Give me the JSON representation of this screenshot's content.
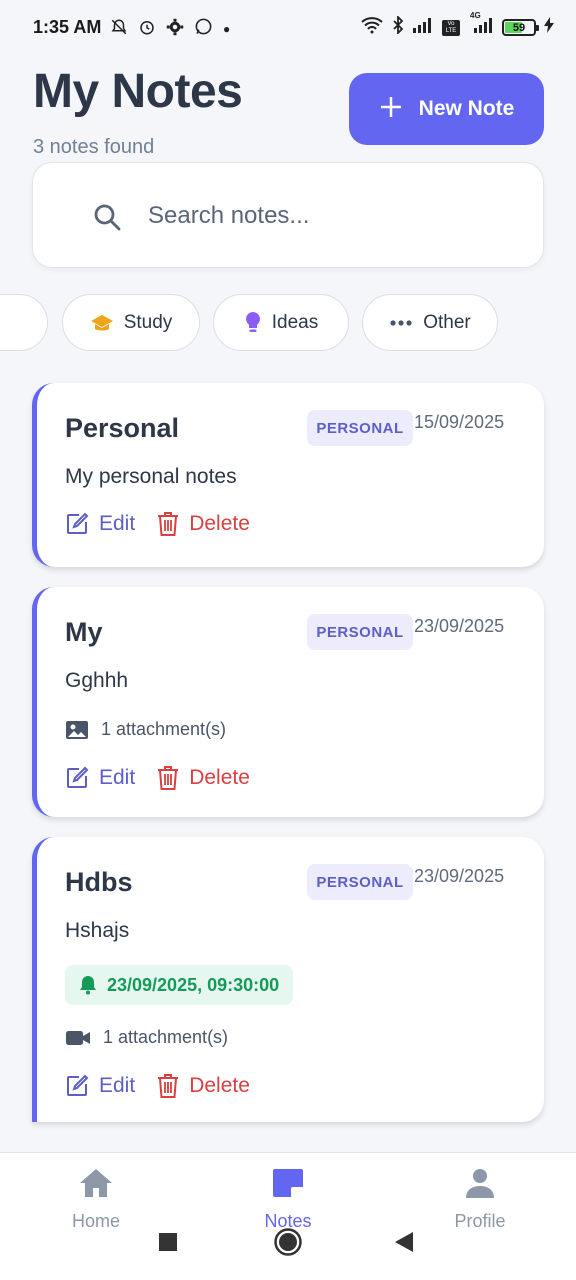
{
  "status_bar": {
    "time": "1:35 AM",
    "battery": "59",
    "left_icons": [
      "mute-icon",
      "alarm-icon",
      "gear-icon",
      "whatsapp-icon"
    ],
    "right_icons": [
      "wifi-icon",
      "bluetooth-icon",
      "signal-icon",
      "volte-icon",
      "signal-4g-icon",
      "battery-icon",
      "charging-icon"
    ],
    "volte": "Vo LTE",
    "network": "4G"
  },
  "header": {
    "title": "My Notes",
    "count_text": "3 notes found",
    "new_note_label": "New Note"
  },
  "search": {
    "placeholder": "Search notes..."
  },
  "categories": [
    {
      "label": "Study",
      "icon": "graduation-cap-icon",
      "color": "#f0a418"
    },
    {
      "label": "Ideas",
      "icon": "lightbulb-icon",
      "color": "#8b5cf6"
    },
    {
      "label": "Other",
      "icon": "more-icon",
      "color": "#4a5568"
    }
  ],
  "notes": [
    {
      "title": "Personal",
      "badge": "PERSONAL",
      "date": "15/09/2025",
      "content": "My personal notes",
      "edit_label": "Edit",
      "delete_label": "Delete"
    },
    {
      "title": "My",
      "badge": "PERSONAL",
      "date": "23/09/2025",
      "content": "Gghhh",
      "attachment": "1 attachment(s)",
      "attachment_icon": "image-icon",
      "edit_label": "Edit",
      "delete_label": "Delete"
    },
    {
      "title": "Hdbs",
      "badge": "PERSONAL",
      "date": "23/09/2025",
      "content": "Hshajs",
      "reminder": "23/09/2025, 09:30:00",
      "attachment": "1 attachment(s)",
      "attachment_icon": "video-icon",
      "edit_label": "Edit",
      "delete_label": "Delete"
    }
  ],
  "bottom_nav": {
    "items": [
      {
        "label": "Home",
        "icon": "home-icon"
      },
      {
        "label": "Notes",
        "icon": "notes-icon",
        "active": true
      },
      {
        "label": "Profile",
        "icon": "profile-icon"
      }
    ]
  },
  "colors": {
    "accent": "#6366f1",
    "delete": "#d94040",
    "reminder": "#159a5a",
    "background": "#f5f6fa"
  }
}
